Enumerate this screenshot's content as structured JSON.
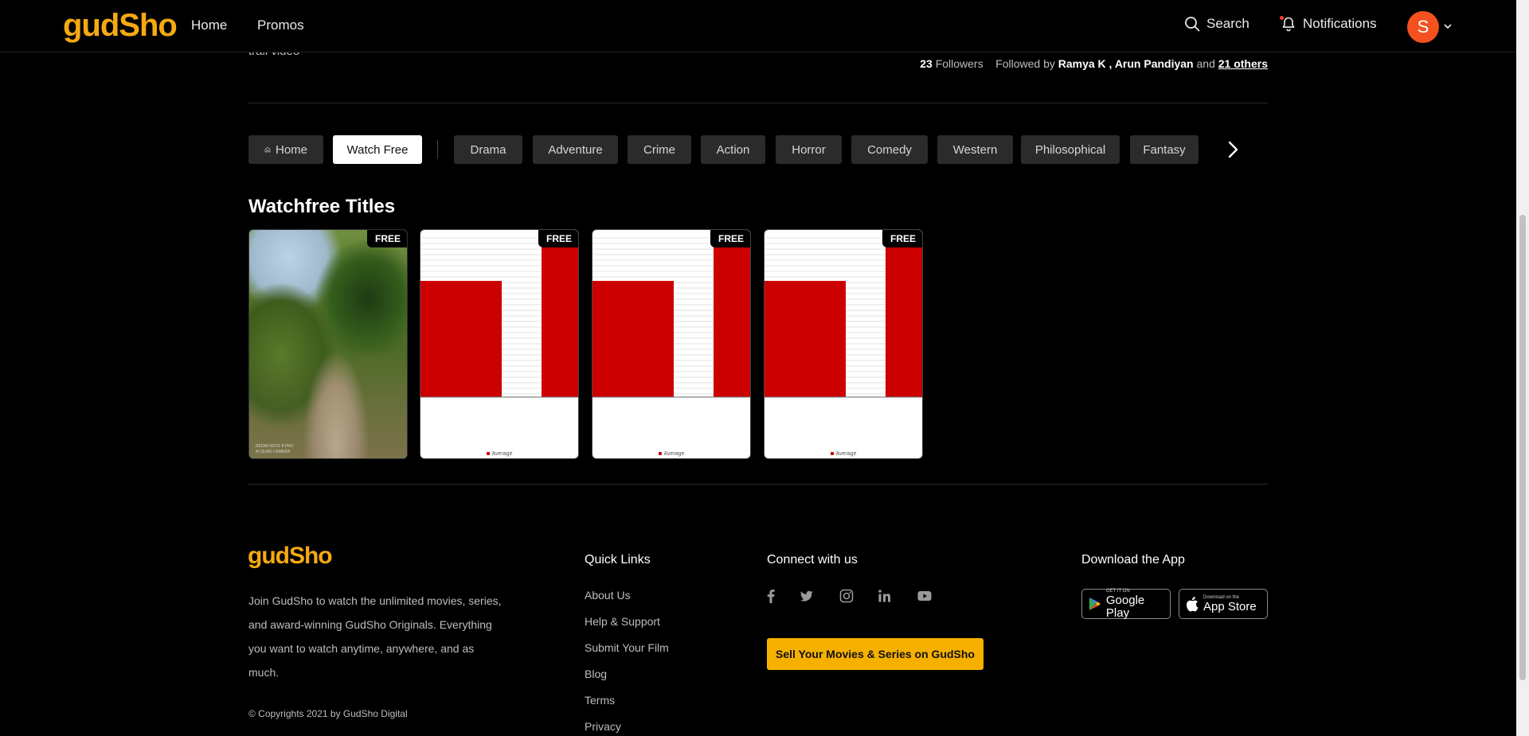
{
  "nav": {
    "logo": "gudSho",
    "links": [
      "Home",
      "Promos"
    ],
    "search_label": "Search",
    "notifications_label": "Notifications",
    "avatar_initial": "S"
  },
  "channel": {
    "trail_text": "trail video",
    "followers_count": "23",
    "followers_label": "Followers",
    "followed_by_prefix": "Followed by",
    "followed_by_names": "Ramya K , Arun Pandiyan",
    "and_label": "and",
    "others_link": "21 others"
  },
  "categories": {
    "home": "Home",
    "watch_free": "Watch Free",
    "genres": [
      "Drama",
      "Adventure",
      "Crime",
      "Action",
      "Horror",
      "Comedy",
      "Western",
      "Philosophical",
      "Fantasy"
    ]
  },
  "section": {
    "title": "Watchfree Titles",
    "cards": [
      {
        "badge": "FREE",
        "kind": "photo",
        "watermark_1": "REDMI NOTE 8 PRO",
        "watermark_2": "AI QUAD CAMERA"
      },
      {
        "badge": "FREE",
        "kind": "chart",
        "legend": "Average"
      },
      {
        "badge": "FREE",
        "kind": "chart",
        "legend": "Average"
      },
      {
        "badge": "FREE",
        "kind": "chart",
        "legend": "Average"
      }
    ]
  },
  "footer": {
    "logo": "gudSho",
    "about": "Join GudSho to watch the unlimited movies, series, and award-winning GudSho Originals. Everything you want to watch anytime, anywhere, and as much.",
    "copyright": "© Copyrights 2021 by GudSho Digital",
    "quick_links_title": "Quick Links",
    "quick_links": [
      "About Us",
      "Help & Support",
      "Submit Your Film",
      "Blog",
      "Terms",
      "Privacy"
    ],
    "connect_title": "Connect with us",
    "social_icons": [
      "facebook-icon",
      "twitter-icon",
      "instagram-icon",
      "linkedin-icon",
      "youtube-icon"
    ],
    "sell_button": "Sell Your Movies & Series on GudSho",
    "download_title": "Download the App",
    "google_play_small": "GET IT ON",
    "google_play_big": "Google Play",
    "app_store_small": "Download on the",
    "app_store_big": "App Store"
  },
  "colors": {
    "brand": "#f5a912",
    "accent_button": "#f5b000",
    "avatar": "#f4511e",
    "chart_bar": "#cc0000"
  }
}
